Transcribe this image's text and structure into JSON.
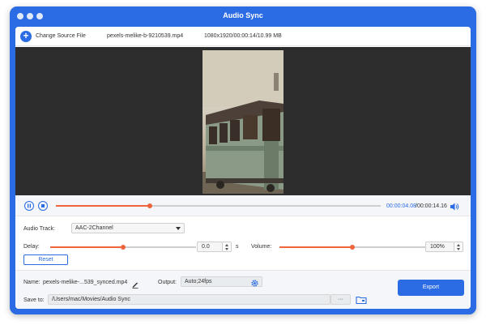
{
  "window": {
    "title": "Audio Sync"
  },
  "file_bar": {
    "change_label": "Change Source File",
    "file_name": "pexels-melike-b-9210539.mp4",
    "file_info": "1080x1920/00:00:14/10.99 MB"
  },
  "playback": {
    "current_time": "00:00:04.08",
    "total_time": "/00:00:14.16",
    "progress": 0.29
  },
  "audio": {
    "track_label": "Audio Track:",
    "track_value": "AAC-2Channel",
    "delay_label": "Delay:",
    "delay_value": "0.0",
    "delay_unit": "s",
    "delay_position": 0.5,
    "volume_label": "Volume:",
    "volume_value": "100%",
    "volume_position": 0.5,
    "reset_label": "Reset"
  },
  "output": {
    "name_label": "Name:",
    "name_value": "pexels-melike-...539_synced.mp4",
    "output_label": "Output:",
    "output_value": "Auto;24fps",
    "save_label": "Save to:",
    "save_path": "/Users/mac/Movies/Audio Sync",
    "browse_label": "···",
    "export_label": "Export"
  },
  "colors": {
    "accent": "#2b6be3",
    "slider": "#f0643c"
  }
}
